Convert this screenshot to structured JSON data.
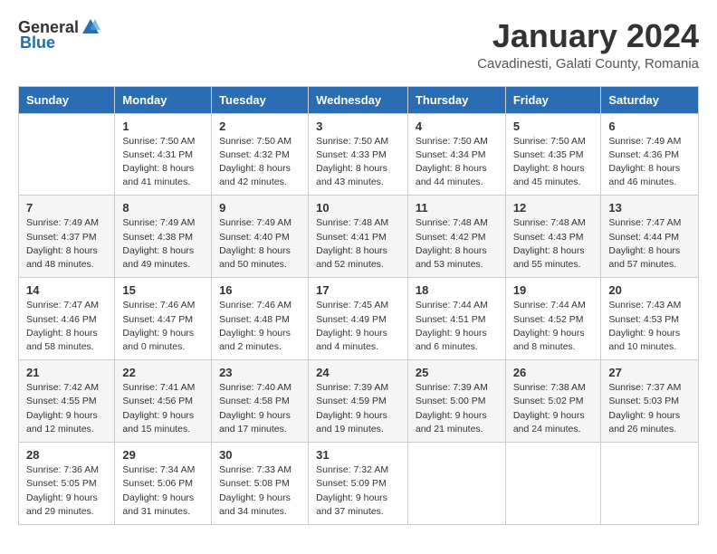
{
  "logo": {
    "general": "General",
    "blue": "Blue"
  },
  "title": "January 2024",
  "location": "Cavadinesti, Galati County, Romania",
  "weekdays": [
    "Sunday",
    "Monday",
    "Tuesday",
    "Wednesday",
    "Thursday",
    "Friday",
    "Saturday"
  ],
  "weeks": [
    [
      {
        "day": "",
        "details": ""
      },
      {
        "day": "1",
        "details": "Sunrise: 7:50 AM\nSunset: 4:31 PM\nDaylight: 8 hours\nand 41 minutes."
      },
      {
        "day": "2",
        "details": "Sunrise: 7:50 AM\nSunset: 4:32 PM\nDaylight: 8 hours\nand 42 minutes."
      },
      {
        "day": "3",
        "details": "Sunrise: 7:50 AM\nSunset: 4:33 PM\nDaylight: 8 hours\nand 43 minutes."
      },
      {
        "day": "4",
        "details": "Sunrise: 7:50 AM\nSunset: 4:34 PM\nDaylight: 8 hours\nand 44 minutes."
      },
      {
        "day": "5",
        "details": "Sunrise: 7:50 AM\nSunset: 4:35 PM\nDaylight: 8 hours\nand 45 minutes."
      },
      {
        "day": "6",
        "details": "Sunrise: 7:49 AM\nSunset: 4:36 PM\nDaylight: 8 hours\nand 46 minutes."
      }
    ],
    [
      {
        "day": "7",
        "details": "Sunrise: 7:49 AM\nSunset: 4:37 PM\nDaylight: 8 hours\nand 48 minutes."
      },
      {
        "day": "8",
        "details": "Sunrise: 7:49 AM\nSunset: 4:38 PM\nDaylight: 8 hours\nand 49 minutes."
      },
      {
        "day": "9",
        "details": "Sunrise: 7:49 AM\nSunset: 4:40 PM\nDaylight: 8 hours\nand 50 minutes."
      },
      {
        "day": "10",
        "details": "Sunrise: 7:48 AM\nSunset: 4:41 PM\nDaylight: 8 hours\nand 52 minutes."
      },
      {
        "day": "11",
        "details": "Sunrise: 7:48 AM\nSunset: 4:42 PM\nDaylight: 8 hours\nand 53 minutes."
      },
      {
        "day": "12",
        "details": "Sunrise: 7:48 AM\nSunset: 4:43 PM\nDaylight: 8 hours\nand 55 minutes."
      },
      {
        "day": "13",
        "details": "Sunrise: 7:47 AM\nSunset: 4:44 PM\nDaylight: 8 hours\nand 57 minutes."
      }
    ],
    [
      {
        "day": "14",
        "details": "Sunrise: 7:47 AM\nSunset: 4:46 PM\nDaylight: 8 hours\nand 58 minutes."
      },
      {
        "day": "15",
        "details": "Sunrise: 7:46 AM\nSunset: 4:47 PM\nDaylight: 9 hours\nand 0 minutes."
      },
      {
        "day": "16",
        "details": "Sunrise: 7:46 AM\nSunset: 4:48 PM\nDaylight: 9 hours\nand 2 minutes."
      },
      {
        "day": "17",
        "details": "Sunrise: 7:45 AM\nSunset: 4:49 PM\nDaylight: 9 hours\nand 4 minutes."
      },
      {
        "day": "18",
        "details": "Sunrise: 7:44 AM\nSunset: 4:51 PM\nDaylight: 9 hours\nand 6 minutes."
      },
      {
        "day": "19",
        "details": "Sunrise: 7:44 AM\nSunset: 4:52 PM\nDaylight: 9 hours\nand 8 minutes."
      },
      {
        "day": "20",
        "details": "Sunrise: 7:43 AM\nSunset: 4:53 PM\nDaylight: 9 hours\nand 10 minutes."
      }
    ],
    [
      {
        "day": "21",
        "details": "Sunrise: 7:42 AM\nSunset: 4:55 PM\nDaylight: 9 hours\nand 12 minutes."
      },
      {
        "day": "22",
        "details": "Sunrise: 7:41 AM\nSunset: 4:56 PM\nDaylight: 9 hours\nand 15 minutes."
      },
      {
        "day": "23",
        "details": "Sunrise: 7:40 AM\nSunset: 4:58 PM\nDaylight: 9 hours\nand 17 minutes."
      },
      {
        "day": "24",
        "details": "Sunrise: 7:39 AM\nSunset: 4:59 PM\nDaylight: 9 hours\nand 19 minutes."
      },
      {
        "day": "25",
        "details": "Sunrise: 7:39 AM\nSunset: 5:00 PM\nDaylight: 9 hours\nand 21 minutes."
      },
      {
        "day": "26",
        "details": "Sunrise: 7:38 AM\nSunset: 5:02 PM\nDaylight: 9 hours\nand 24 minutes."
      },
      {
        "day": "27",
        "details": "Sunrise: 7:37 AM\nSunset: 5:03 PM\nDaylight: 9 hours\nand 26 minutes."
      }
    ],
    [
      {
        "day": "28",
        "details": "Sunrise: 7:36 AM\nSunset: 5:05 PM\nDaylight: 9 hours\nand 29 minutes."
      },
      {
        "day": "29",
        "details": "Sunrise: 7:34 AM\nSunset: 5:06 PM\nDaylight: 9 hours\nand 31 minutes."
      },
      {
        "day": "30",
        "details": "Sunrise: 7:33 AM\nSunset: 5:08 PM\nDaylight: 9 hours\nand 34 minutes."
      },
      {
        "day": "31",
        "details": "Sunrise: 7:32 AM\nSunset: 5:09 PM\nDaylight: 9 hours\nand 37 minutes."
      },
      {
        "day": "",
        "details": ""
      },
      {
        "day": "",
        "details": ""
      },
      {
        "day": "",
        "details": ""
      }
    ]
  ]
}
